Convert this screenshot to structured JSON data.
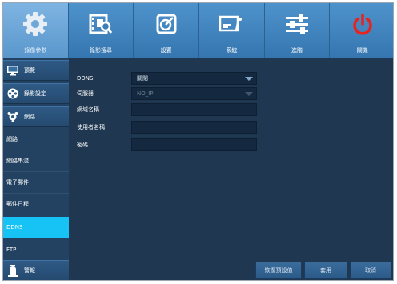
{
  "toolbar": {
    "items": [
      {
        "label": "錄像參數",
        "icon": "gear-icon"
      },
      {
        "label": "錄影搜尋",
        "icon": "film-search-icon"
      },
      {
        "label": "設置",
        "icon": "disk-icon"
      },
      {
        "label": "系統",
        "icon": "monitor-info-icon"
      },
      {
        "label": "進階",
        "icon": "sliders-icon"
      },
      {
        "label": "關機",
        "icon": "power-icon"
      }
    ],
    "active_index": 0
  },
  "sidebar": {
    "categories": [
      {
        "label": "預覽",
        "icon": "monitor-icon"
      },
      {
        "label": "錄影設定",
        "icon": "film-reel-icon"
      },
      {
        "label": "網路",
        "icon": "network-globe-icon"
      }
    ],
    "subitems": [
      "網路",
      "網路串流",
      "電子郵件",
      "郵件日程",
      "DDNS",
      "FTP"
    ],
    "active_subitem": "DDNS",
    "bottom_category": {
      "label": "警報",
      "icon": "alarm-icon"
    }
  },
  "form": {
    "ddns": {
      "label": "DDNS",
      "value": "關閉"
    },
    "server": {
      "label": "伺服器",
      "value": "NO_IP"
    },
    "hostname": {
      "label": "網域名稱",
      "value": ""
    },
    "username": {
      "label": "使用者名稱",
      "value": ""
    },
    "password": {
      "label": "密碼",
      "value": ""
    }
  },
  "buttons": {
    "default": "恢復預設值",
    "apply": "套用",
    "cancel": "取消"
  },
  "colors": {
    "accent": "#16c3f4",
    "power": "#e8231f",
    "toolbar": "#3d7eb8",
    "background": "#1f3750"
  }
}
